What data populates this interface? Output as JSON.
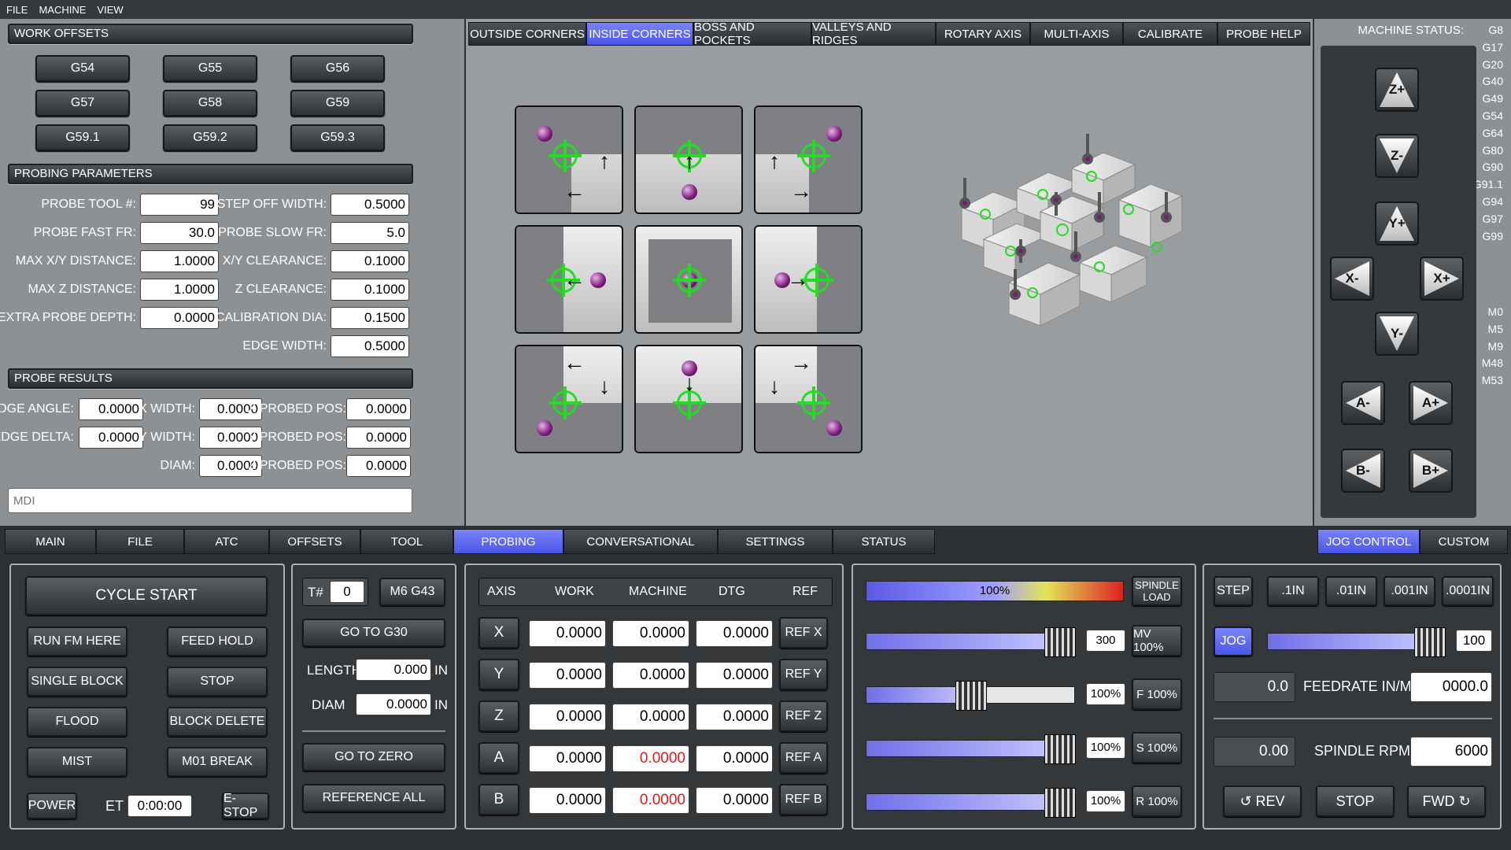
{
  "menubar": {
    "file": "FILE",
    "machine": "MACHINE",
    "view": "VIEW"
  },
  "work_offsets": {
    "title": "WORK OFFSETS",
    "buttons": [
      "G54",
      "G55",
      "G56",
      "G57",
      "G58",
      "G59",
      "G59.1",
      "G59.2",
      "G59.3"
    ]
  },
  "probing_parameters": {
    "title": "PROBING PARAMETERS",
    "probe_tool_label": "PROBE TOOL #:",
    "probe_tool": "99",
    "step_off_label": "STEP OFF WIDTH:",
    "step_off": "0.5000",
    "probe_fast_label": "PROBE FAST FR:",
    "probe_fast": "30.0",
    "probe_slow_label": "PROBE SLOW FR:",
    "probe_slow": "5.0",
    "max_xy_label": "MAX X/Y DISTANCE:",
    "max_xy": "1.0000",
    "xy_clear_label": "X/Y CLEARANCE:",
    "xy_clear": "0.1000",
    "max_z_label": "MAX Z DISTANCE:",
    "max_z": "1.0000",
    "z_clear_label": "Z CLEARANCE:",
    "z_clear": "0.1000",
    "extra_depth_label": "EXTRA PROBE DEPTH:",
    "extra_depth": "0.0000",
    "cal_dia_label": "CALIBRATION DIA:",
    "cal_dia": "0.1500",
    "edge_width_label": "EDGE WIDTH:",
    "edge_width": "0.5000"
  },
  "probe_results": {
    "title": "PROBE RESULTS",
    "edge_angle_label": "EDGE ANGLE:",
    "edge_angle": "0.0000",
    "x_width_label": "X WIDTH:",
    "x_width": "0.0000",
    "x_probed_label": "X PROBED POS:",
    "x_probed": "0.0000",
    "edge_delta_label": "EDGE DELTA:",
    "edge_delta": "0.0000",
    "y_width_label": "Y WIDTH:",
    "y_width": "0.0000",
    "y_probed_label": "Y PROBED POS:",
    "y_probed": "0.0000",
    "diam_label": "DIAM:",
    "diam": "0.0000",
    "z_probed_label": "Z PROBED POS:",
    "z_probed": "0.0000"
  },
  "mdi": {
    "placeholder": "MDI"
  },
  "probe_tabs": [
    "OUTSIDE CORNERS",
    "INSIDE CORNERS",
    "BOSS AND POCKETS",
    "VALLEYS AND RIDGES",
    "ROTARY AXIS",
    "MULTI-AXIS",
    "CALIBRATE",
    "PROBE HELP"
  ],
  "machine_status": {
    "label": "MACHINE STATUS:",
    "gcodes": [
      "G8",
      "G17",
      "G20",
      "G40",
      "G49",
      "G54",
      "G64",
      "G80",
      "G90",
      "G91.1",
      "G94",
      "G97",
      "G99"
    ],
    "mcodes": [
      "M0",
      "M5",
      "M9",
      "M48",
      "M53"
    ]
  },
  "jog_buttons": {
    "zp": "Z+",
    "zm": "Z-",
    "yp": "Y+",
    "xm": "X-",
    "xp": "X+",
    "ym": "Y-",
    "am": "A-",
    "ap": "A+",
    "bm": "B-",
    "bp": "B+"
  },
  "main_tabs": [
    "MAIN",
    "FILE",
    "ATC",
    "OFFSETS",
    "TOOL",
    "PROBING",
    "CONVERSATIONAL",
    "SETTINGS",
    "STATUS"
  ],
  "right_tabs": [
    "JOG CONTROL",
    "CUSTOM"
  ],
  "controls": {
    "cycle_start": "CYCLE START",
    "run_fm_here": "RUN FM HERE",
    "feed_hold": "FEED HOLD",
    "single_block": "SINGLE BLOCK",
    "stop": "STOP",
    "flood": "FLOOD",
    "block_delete": "BLOCK DELETE",
    "mist": "MIST",
    "m01_break": "M01 BREAK",
    "power": "POWER",
    "et_label": "ET",
    "et_value": "0:00:00",
    "estop": "E-STOP"
  },
  "tool": {
    "t_label": "T#",
    "t_value": "0",
    "m6g43": "M6 G43",
    "go_g30": "GO TO G30",
    "length_label": "LENGTH",
    "length": "0.000",
    "in1": "IN",
    "diam_label": "DIAM",
    "diam": "0.0000",
    "in2": "IN",
    "go_zero": "GO TO ZERO",
    "reference_all": "REFERENCE ALL"
  },
  "dro": {
    "headers": [
      "AXIS",
      "WORK",
      "MACHINE",
      "DTG",
      "REF"
    ],
    "rows": [
      {
        "axis": "X",
        "work": "0.0000",
        "machine": "0.0000",
        "dtg": "0.0000",
        "ref": "REF X",
        "unhomed": false
      },
      {
        "axis": "Y",
        "work": "0.0000",
        "machine": "0.0000",
        "dtg": "0.0000",
        "ref": "REF Y",
        "unhomed": false
      },
      {
        "axis": "Z",
        "work": "0.0000",
        "machine": "0.0000",
        "dtg": "0.0000",
        "ref": "REF Z",
        "unhomed": false
      },
      {
        "axis": "A",
        "work": "0.0000",
        "machine": "0.0000",
        "dtg": "0.0000",
        "ref": "REF A",
        "unhomed": true
      },
      {
        "axis": "B",
        "work": "0.0000",
        "machine": "0.0000",
        "dtg": "0.0000",
        "ref": "REF B",
        "unhomed": true
      }
    ]
  },
  "overrides": {
    "spindle_load_pct": "100%",
    "spindle_load_label": "SPINDLE LOAD",
    "max_vel": {
      "value": "300",
      "button": "MV 100%",
      "fill": 1.0
    },
    "feed": {
      "value": "100%",
      "button": "F 100%",
      "fill": 0.5
    },
    "spindle": {
      "value": "100%",
      "button": "S 100%",
      "fill": 1.0
    },
    "rapid": {
      "value": "100%",
      "button": "R 100%",
      "fill": 1.0
    }
  },
  "jog": {
    "step": "STEP",
    "inc": [
      ".1IN",
      ".01IN",
      ".001IN",
      ".0001IN"
    ],
    "jog": "JOG",
    "jog_rate": "100",
    "jog_fill": 1.0,
    "feed_actual": "0.0",
    "feed_label": "FEEDRATE IN/M",
    "feed_set": "0000.0",
    "rpm_actual": "0.00",
    "rpm_label": "SPINDLE RPM",
    "rpm_set": "6000",
    "rev": "↺ REV",
    "stop": "STOP",
    "fwd": "FWD ↻"
  },
  "colors": {
    "accent": "#5a64f0",
    "unhomed": "#e01818",
    "target": "#22dd22",
    "ball": "#7a1a7a"
  }
}
